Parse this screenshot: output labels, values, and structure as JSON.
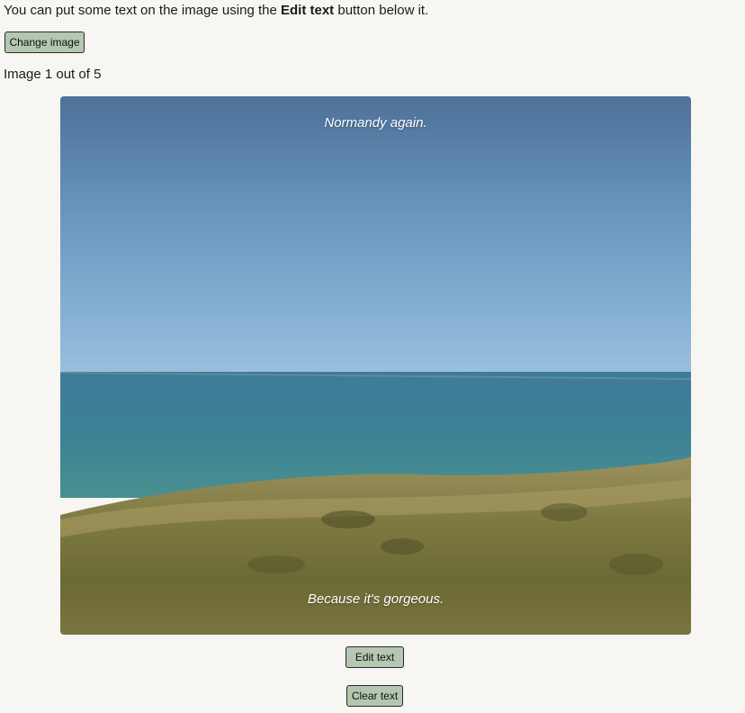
{
  "intro": {
    "prefix": "You can put some text on the image using the",
    "emphasis": "Edit text",
    "suffix": "button below it."
  },
  "buttons": {
    "change_image": "Change image",
    "edit_text": "Edit text",
    "clear_text": "Clear text"
  },
  "counter": "Image 1 out of 5",
  "image": {
    "top_text": "Normandy again.",
    "bottom_text": "Because it's gorgeous."
  },
  "colors": {
    "page_background": "#f7f6f2",
    "button_background": "#b5c7b0",
    "button_border": "#2a2a2a"
  }
}
